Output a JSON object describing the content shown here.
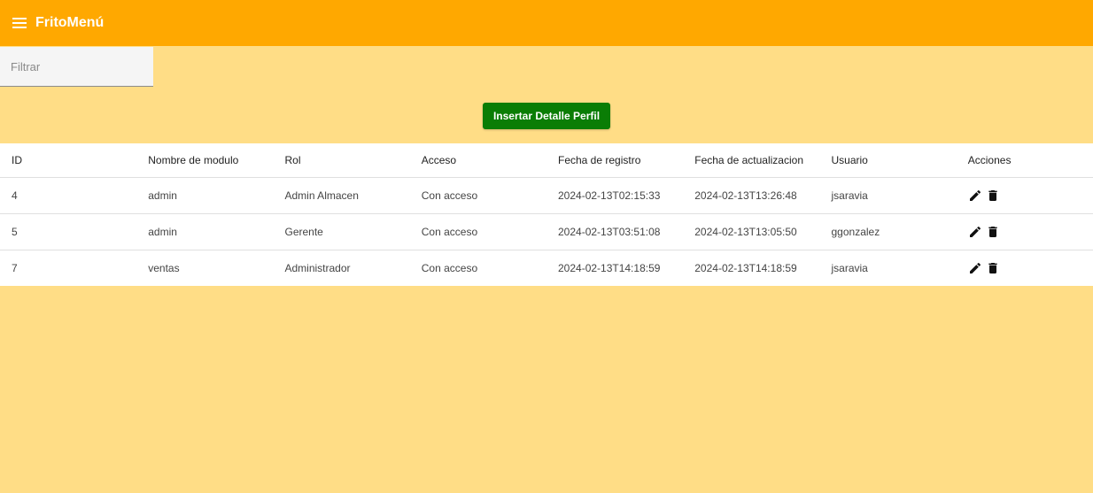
{
  "app": {
    "title": "FritoMenú"
  },
  "filter": {
    "placeholder": "Filtrar",
    "value": ""
  },
  "insert_button": {
    "label": "Insertar Detalle Perfil"
  },
  "table": {
    "headers": [
      "ID",
      "Nombre de modulo",
      "Rol",
      "Acceso",
      "Fecha de registro",
      "Fecha de actualizacion",
      "Usuario",
      "Acciones"
    ],
    "rows": [
      {
        "id": "4",
        "modulo": "admin",
        "rol": "Admin Almacen",
        "acceso": "Con acceso",
        "registro": "2024-02-13T02:15:33",
        "actualizacion": "2024-02-13T13:26:48",
        "usuario": "jsaravia"
      },
      {
        "id": "5",
        "modulo": "admin",
        "rol": "Gerente",
        "acceso": "Con acceso",
        "registro": "2024-02-13T03:51:08",
        "actualizacion": "2024-02-13T13:05:50",
        "usuario": "ggonzalez"
      },
      {
        "id": "7",
        "modulo": "ventas",
        "rol": "Administrador",
        "acceso": "Con acceso",
        "registro": "2024-02-13T14:18:59",
        "actualizacion": "2024-02-13T14:18:59",
        "usuario": "jsaravia"
      }
    ]
  },
  "icons": {
    "menu": "menu-icon",
    "edit": "edit-icon",
    "delete": "delete-icon"
  },
  "colors": {
    "toolbar": "#ffa800",
    "background": "#ffdd86",
    "button": "#0a7d05"
  }
}
